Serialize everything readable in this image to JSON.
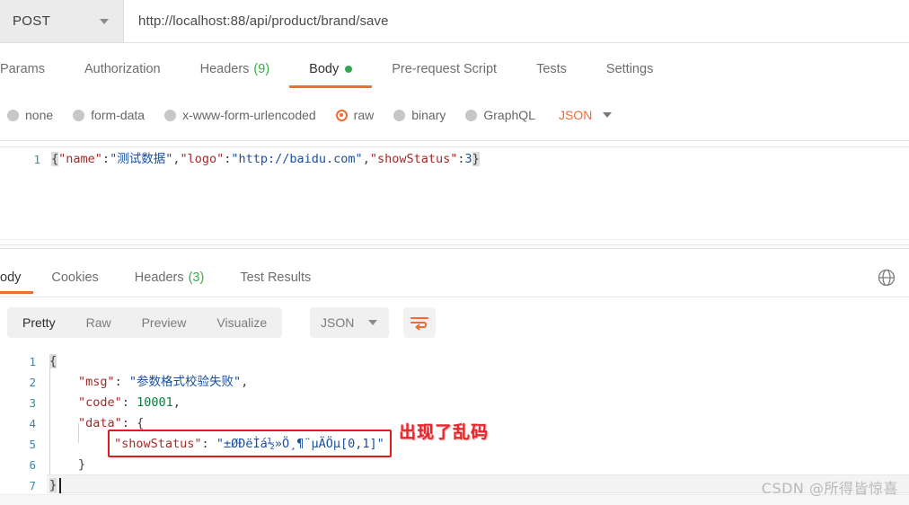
{
  "request": {
    "method": "POST",
    "url": "http://localhost:88/api/product/brand/save",
    "tabs": [
      {
        "label": "Params",
        "count": "",
        "active": false
      },
      {
        "label": "Authorization",
        "count": "",
        "active": false
      },
      {
        "label": "Headers",
        "count": "(9)",
        "active": false
      },
      {
        "label": "Body",
        "count": "",
        "active": true
      },
      {
        "label": "Pre-request Script",
        "count": "",
        "active": false
      },
      {
        "label": "Tests",
        "count": "",
        "active": false
      },
      {
        "label": "Settings",
        "count": "",
        "active": false
      }
    ],
    "body_types": [
      {
        "label": "none",
        "selected": false
      },
      {
        "label": "form-data",
        "selected": false
      },
      {
        "label": "x-www-form-urlencoded",
        "selected": false
      },
      {
        "label": "raw",
        "selected": true
      },
      {
        "label": "binary",
        "selected": false
      },
      {
        "label": "GraphQL",
        "selected": false
      }
    ],
    "format_label": "JSON",
    "editor": {
      "line_numbers": [
        "1"
      ],
      "line1": {
        "open_brace": "{",
        "key_name": "\"name\"",
        "colon1": ":",
        "val_name": "\"测试数据\"",
        "comma1": ",",
        "key_logo": "\"logo\"",
        "colon2": ":",
        "val_logo": "\"http://baidu.com\"",
        "comma2": ",",
        "key_showstatus": "\"showStatus\"",
        "colon3": ":",
        "val_showstatus": "3",
        "close_brace": "}"
      },
      "raw_text": "{\"name\":\"测试数据\",\"logo\":\"http://baidu.com\",\"showStatus\":3}"
    }
  },
  "response": {
    "tabs": [
      {
        "label": "ody",
        "count": "",
        "active": true
      },
      {
        "label": "Cookies",
        "count": "",
        "active": false
      },
      {
        "label": "Headers",
        "count": "(3)",
        "active": false
      },
      {
        "label": "Test Results",
        "count": "",
        "active": false
      }
    ],
    "globe_icon": "globe-icon",
    "view_modes": [
      {
        "label": "Pretty",
        "active": true
      },
      {
        "label": "Raw",
        "active": false
      },
      {
        "label": "Preview",
        "active": false
      },
      {
        "label": "Visualize",
        "active": false
      }
    ],
    "format_label": "JSON",
    "wrap_icon": "wrap-text-icon",
    "editor": {
      "line_numbers": [
        "1",
        "2",
        "3",
        "4",
        "5",
        "6",
        "7"
      ],
      "lines": {
        "l1_brace": "{",
        "l2_key": "\"msg\"",
        "l2_colon": ":",
        "l2_val": "\"参数格式校验失败\"",
        "l2_comma": ",",
        "l3_key": "\"code\"",
        "l3_colon": ":",
        "l3_val": "10001",
        "l3_comma": ",",
        "l4_key": "\"data\"",
        "l4_colon": ":",
        "l4_brace": "{",
        "l5_key": "\"showStatus\"",
        "l5_colon": ":",
        "l5_val": "\"±ØÐëÌá½»Ö¸¶¨µÄÖµ[0,1]\"",
        "l6_brace": "}",
        "l7_brace": "}"
      },
      "raw_text": "{\n    \"msg\": \"参数格式校验失败\",\n    \"code\": 10001,\n    \"data\": {\n        \"showStatus\": \"±ØÐëÌá½»Ö¸¶¨µÄÖµ[0,1]\"\n    }\n}"
    }
  },
  "annotation": {
    "text": "出现了乱码",
    "color": "#e8252c"
  },
  "watermark": {
    "text": "CSDN @所得皆惊喜"
  },
  "colors": {
    "accent_orange": "#ef6c33",
    "green": "#3aaa4a",
    "json_key": "#a52a2a",
    "json_string": "#1a4f9c",
    "json_number": "#0f7b3f",
    "gutter_blue": "#3f87a6",
    "red_box": "#e01b1b"
  }
}
